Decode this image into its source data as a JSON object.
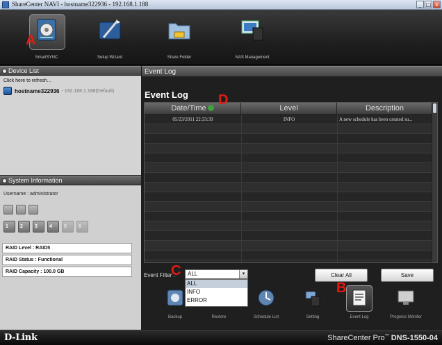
{
  "window": {
    "title": "ShareCenter NAVI - hostname322936 - 192.168.1.188",
    "buttons": [
      "_",
      "□",
      "x"
    ]
  },
  "toolbar": {
    "items": [
      {
        "label": "SmartSYNC",
        "icon": "smartsync-icon",
        "active": true
      },
      {
        "label": "Setup Wizard",
        "icon": "setup-wizard-icon",
        "active": false
      },
      {
        "label": "Share Folder",
        "icon": "share-folder-icon",
        "active": false
      },
      {
        "label": "NAS Management",
        "icon": "nas-management-icon",
        "active": false
      }
    ]
  },
  "markers": {
    "a": "A",
    "b": "B",
    "c": "C",
    "d": "D"
  },
  "device_list": {
    "header": "Device List",
    "refresh": "Click here to refresh...",
    "host_name": "hostname322936",
    "host_ip": "- 192.168.1.188(Default)"
  },
  "system_info": {
    "header": "System Information",
    "username": "Username : administrator",
    "disks": [
      "1",
      "2",
      "3",
      "4",
      "5",
      "6"
    ],
    "raid_level": "RAID Level : RAID5",
    "raid_status": "RAID Status : Functional",
    "raid_capacity": "RAID Capacity : 100.0 GB"
  },
  "event_log": {
    "header": "Event Log",
    "title": "Event Log",
    "columns": [
      "Date/Time",
      "Level",
      "Description"
    ],
    "rows": [
      {
        "datetime": "05/23/2011 22:33:39",
        "level": "INFO",
        "description": "A new schedule has been created su..."
      }
    ],
    "filter_label": "Event Filter :",
    "filter_value": "ALL",
    "filter_options": [
      "ALL",
      "INFO",
      "ERROR"
    ],
    "clear_all": "Clear All",
    "save": "Save"
  },
  "bottom_tools": [
    {
      "label": "Backup",
      "icon": "backup-icon"
    },
    {
      "label": "Restore",
      "icon": "restore-icon"
    },
    {
      "label": "Schedule List",
      "icon": "schedule-list-icon"
    },
    {
      "label": "Setting",
      "icon": "setting-icon"
    },
    {
      "label": "Event Log",
      "icon": "event-log-icon"
    },
    {
      "label": "Progress Monitor",
      "icon": "progress-monitor-icon"
    }
  ],
  "footer": {
    "logo": "D-Link",
    "brand": "ShareCenter Pro",
    "tm": "™",
    "model": "DNS-1550-04"
  }
}
